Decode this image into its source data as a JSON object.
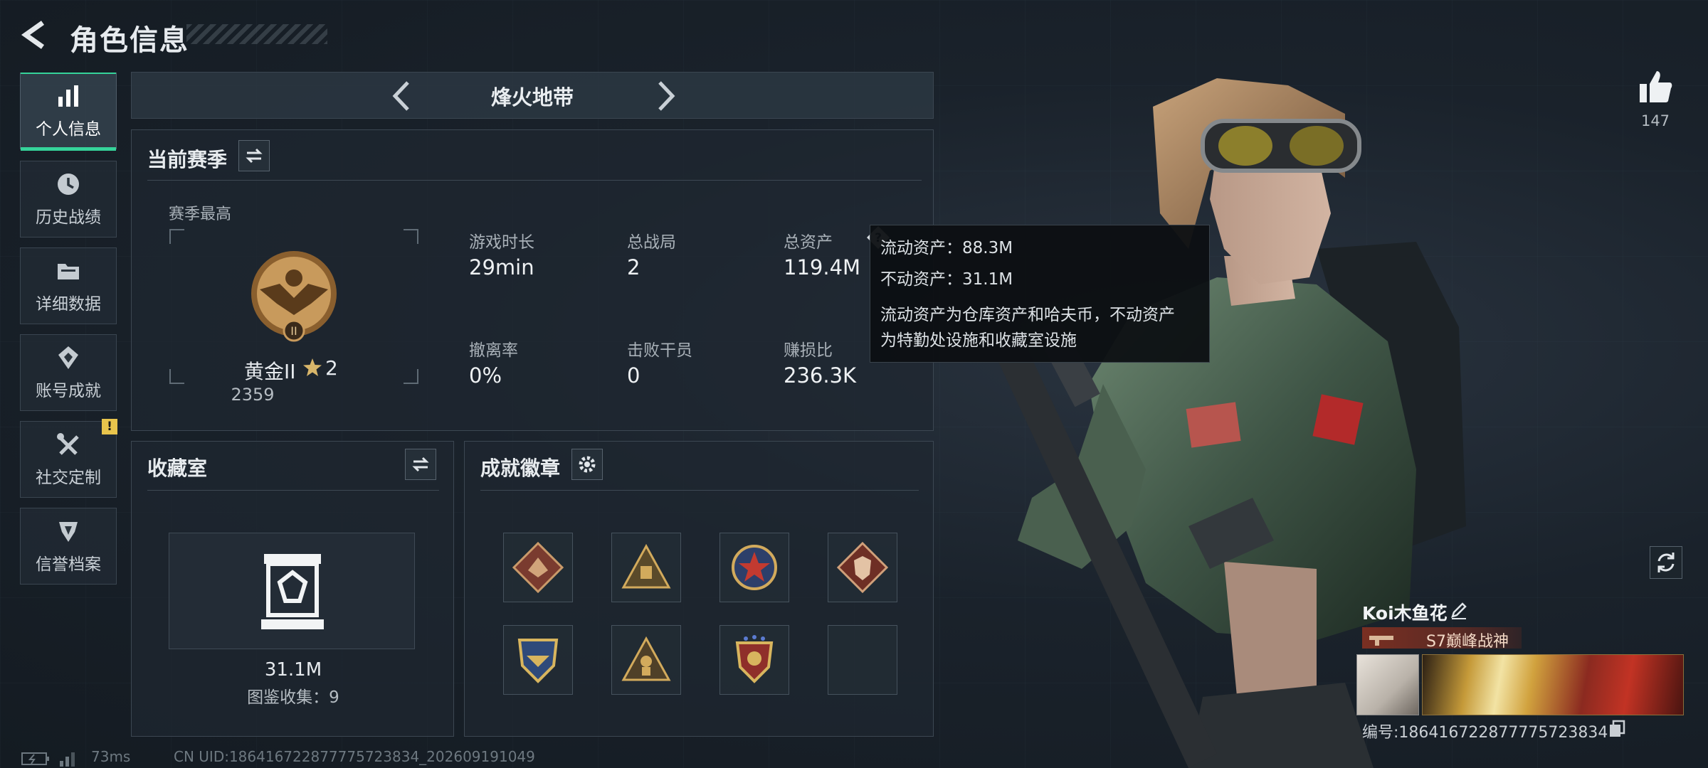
{
  "header": {
    "title": "角色信息"
  },
  "sidebar": {
    "items": [
      {
        "label": "个人信息",
        "icon": "bar-chart-icon",
        "active": true
      },
      {
        "label": "历史战绩",
        "icon": "clock-icon"
      },
      {
        "label": "详细数据",
        "icon": "folder-icon"
      },
      {
        "label": "账号成就",
        "icon": "achievement-icon"
      },
      {
        "label": "社交定制",
        "icon": "tools-icon",
        "badge": "!"
      },
      {
        "label": "信誉档案",
        "icon": "shield-icon"
      }
    ]
  },
  "mode": {
    "label": "烽火地带"
  },
  "season": {
    "title": "当前赛季",
    "best_label": "赛季最高",
    "rank_name": "黄金II",
    "rank_stars": "2",
    "rank_score": "2359",
    "stats": [
      {
        "label": "游戏时长",
        "value": "29min"
      },
      {
        "label": "总战局",
        "value": "2"
      },
      {
        "label": "总资产",
        "value": "119.4M"
      },
      {
        "label": "撤离率",
        "value": "0%"
      },
      {
        "label": "击败干员",
        "value": "0"
      },
      {
        "label": "赚损比",
        "value": "236.3K"
      }
    ],
    "help_icon": "?"
  },
  "tooltip": {
    "line1": "流动资产：88.3M",
    "line2": "不动资产：31.1M",
    "desc1": "流动资产为仓库资产和哈夫币，不动资产",
    "desc2": "为特勤处设施和收藏室设施"
  },
  "collection": {
    "title": "收藏室",
    "value": "31.1M",
    "count_text": "图鉴收集：9"
  },
  "badges": {
    "title": "成就徽章",
    "items": [
      "dragon-badge",
      "pyramid-badge",
      "star-shield-badge",
      "wolf-badge",
      "eagle-shield-badge",
      "warrior-badge",
      "crest-badge",
      "empty-slot"
    ]
  },
  "player": {
    "likes": "147",
    "name": "Koi木鱼花",
    "title": "S7巅峰战神",
    "id_text": "编号:1864167228777757238​34"
  },
  "footer": {
    "ping": "73ms",
    "uid": "CN UID:18641672287777572383​4_202609191049"
  },
  "colors": {
    "accent": "#35d39a",
    "warning": "#e8c44c",
    "panel": "#1e2730"
  }
}
